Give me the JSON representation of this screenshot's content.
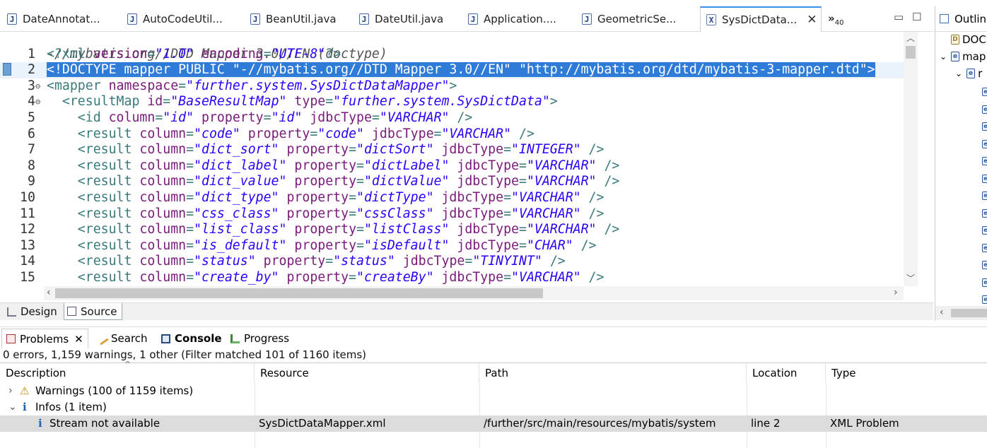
{
  "tabs": [
    {
      "label": "DateAnnotat...",
      "icon": "java-file-icon"
    },
    {
      "label": "AutoCodeUtil...",
      "icon": "java-file-icon"
    },
    {
      "label": "BeanUtil.java",
      "icon": "java-file-icon"
    },
    {
      "label": "DateUtil.java",
      "icon": "java-file-icon"
    },
    {
      "label": "Application....",
      "icon": "java-file-icon"
    },
    {
      "label": "GeometricSe...",
      "icon": "java-file-icon"
    },
    {
      "label": "SysDictData...",
      "icon": "xml-file-icon",
      "active": true
    }
  ],
  "tab_overflow": {
    "symbol": "»",
    "count": "40"
  },
  "editor": {
    "doctype_hint": "-//mybatis.org//DTD Mapper 3.0//EN (doctype)",
    "lines": [
      {
        "n": "1",
        "seg": [
          [
            "pi",
            "<?xml "
          ],
          [
            "att",
            "version"
          ],
          [
            "tag",
            "="
          ],
          [
            "val",
            "\"1.0\""
          ],
          [
            "att",
            " encoding"
          ],
          [
            "tag",
            "="
          ],
          [
            "val",
            "\"UTF-8\""
          ],
          [
            "pi",
            "?>"
          ]
        ]
      },
      {
        "n": "2",
        "selected": true,
        "seg": [
          [
            "sel",
            "<!DOCTYPE mapper PUBLIC \"-//mybatis.org//DTD Mapper 3.0//EN\" \"http://mybatis.org/dtd/mybatis-3-mapper.dtd\">"
          ]
        ]
      },
      {
        "n": "3",
        "fold": "⊖",
        "seg": [
          [
            "tag",
            "<mapper "
          ],
          [
            "att",
            "namespace"
          ],
          [
            "tag",
            "="
          ],
          [
            "val",
            "\"further.system.SysDictDataMapper\""
          ],
          [
            "tag",
            ">"
          ]
        ]
      },
      {
        "n": "4",
        "fold": "⊖",
        "seg": [
          [
            "tag",
            "  <resultMap "
          ],
          [
            "att",
            "id"
          ],
          [
            "tag",
            "="
          ],
          [
            "val",
            "\"BaseResultMap\""
          ],
          [
            "att",
            " type"
          ],
          [
            "tag",
            "="
          ],
          [
            "val",
            "\"further.system.SysDictData\""
          ],
          [
            "tag",
            ">"
          ]
        ]
      },
      {
        "n": "5",
        "seg": [
          [
            "tag",
            "    <id "
          ],
          [
            "att",
            "column"
          ],
          [
            "tag",
            "="
          ],
          [
            "val",
            "\"id\""
          ],
          [
            "att",
            " property"
          ],
          [
            "tag",
            "="
          ],
          [
            "val",
            "\"id\""
          ],
          [
            "att",
            " jdbcType"
          ],
          [
            "tag",
            "="
          ],
          [
            "val",
            "\"VARCHAR\""
          ],
          [
            "tag",
            " />"
          ]
        ]
      },
      {
        "n": "6",
        "seg": [
          [
            "tag",
            "    <result "
          ],
          [
            "att",
            "column"
          ],
          [
            "tag",
            "="
          ],
          [
            "val",
            "\"code\""
          ],
          [
            "att",
            " property"
          ],
          [
            "tag",
            "="
          ],
          [
            "val",
            "\"code\""
          ],
          [
            "att",
            " jdbcType"
          ],
          [
            "tag",
            "="
          ],
          [
            "val",
            "\"VARCHAR\""
          ],
          [
            "tag",
            " />"
          ]
        ]
      },
      {
        "n": "7",
        "seg": [
          [
            "tag",
            "    <result "
          ],
          [
            "att",
            "column"
          ],
          [
            "tag",
            "="
          ],
          [
            "val",
            "\"dict_sort\""
          ],
          [
            "att",
            " property"
          ],
          [
            "tag",
            "="
          ],
          [
            "val",
            "\"dictSort\""
          ],
          [
            "att",
            " jdbcType"
          ],
          [
            "tag",
            "="
          ],
          [
            "val",
            "\"INTEGER\""
          ],
          [
            "tag",
            " />"
          ]
        ]
      },
      {
        "n": "8",
        "seg": [
          [
            "tag",
            "    <result "
          ],
          [
            "att",
            "column"
          ],
          [
            "tag",
            "="
          ],
          [
            "val",
            "\"dict_label\""
          ],
          [
            "att",
            " property"
          ],
          [
            "tag",
            "="
          ],
          [
            "val",
            "\"dictLabel\""
          ],
          [
            "att",
            " jdbcType"
          ],
          [
            "tag",
            "="
          ],
          [
            "val",
            "\"VARCHAR\""
          ],
          [
            "tag",
            " />"
          ]
        ]
      },
      {
        "n": "9",
        "seg": [
          [
            "tag",
            "    <result "
          ],
          [
            "att",
            "column"
          ],
          [
            "tag",
            "="
          ],
          [
            "val",
            "\"dict_value\""
          ],
          [
            "att",
            " property"
          ],
          [
            "tag",
            "="
          ],
          [
            "val",
            "\"dictValue\""
          ],
          [
            "att",
            " jdbcType"
          ],
          [
            "tag",
            "="
          ],
          [
            "val",
            "\"VARCHAR\""
          ],
          [
            "tag",
            " />"
          ]
        ]
      },
      {
        "n": "10",
        "seg": [
          [
            "tag",
            "    <result "
          ],
          [
            "att",
            "column"
          ],
          [
            "tag",
            "="
          ],
          [
            "val",
            "\"dict_type\""
          ],
          [
            "att",
            " property"
          ],
          [
            "tag",
            "="
          ],
          [
            "val",
            "\"dictType\""
          ],
          [
            "att",
            " jdbcType"
          ],
          [
            "tag",
            "="
          ],
          [
            "val",
            "\"VARCHAR\""
          ],
          [
            "tag",
            " />"
          ]
        ]
      },
      {
        "n": "11",
        "seg": [
          [
            "tag",
            "    <result "
          ],
          [
            "att",
            "column"
          ],
          [
            "tag",
            "="
          ],
          [
            "val",
            "\"css_class\""
          ],
          [
            "att",
            " property"
          ],
          [
            "tag",
            "="
          ],
          [
            "val",
            "\"cssClass\""
          ],
          [
            "att",
            " jdbcType"
          ],
          [
            "tag",
            "="
          ],
          [
            "val",
            "\"VARCHAR\""
          ],
          [
            "tag",
            " />"
          ]
        ]
      },
      {
        "n": "12",
        "seg": [
          [
            "tag",
            "    <result "
          ],
          [
            "att",
            "column"
          ],
          [
            "tag",
            "="
          ],
          [
            "val",
            "\"list_class\""
          ],
          [
            "att",
            " property"
          ],
          [
            "tag",
            "="
          ],
          [
            "val",
            "\"listClass\""
          ],
          [
            "att",
            " jdbcType"
          ],
          [
            "tag",
            "="
          ],
          [
            "val",
            "\"VARCHAR\""
          ],
          [
            "tag",
            " />"
          ]
        ]
      },
      {
        "n": "13",
        "seg": [
          [
            "tag",
            "    <result "
          ],
          [
            "att",
            "column"
          ],
          [
            "tag",
            "="
          ],
          [
            "val",
            "\"is_default\""
          ],
          [
            "att",
            " property"
          ],
          [
            "tag",
            "="
          ],
          [
            "val",
            "\"isDefault\""
          ],
          [
            "att",
            " jdbcType"
          ],
          [
            "tag",
            "="
          ],
          [
            "val",
            "\"CHAR\""
          ],
          [
            "tag",
            " />"
          ]
        ]
      },
      {
        "n": "14",
        "seg": [
          [
            "tag",
            "    <result "
          ],
          [
            "att",
            "column"
          ],
          [
            "tag",
            "="
          ],
          [
            "val",
            "\"status\""
          ],
          [
            "att",
            " property"
          ],
          [
            "tag",
            "="
          ],
          [
            "val",
            "\"status\""
          ],
          [
            "att",
            " jdbcType"
          ],
          [
            "tag",
            "="
          ],
          [
            "val",
            "\"TINYINT\""
          ],
          [
            "tag",
            " />"
          ]
        ]
      },
      {
        "n": "15",
        "seg": [
          [
            "tag",
            "    <result "
          ],
          [
            "att",
            "column"
          ],
          [
            "tag",
            "="
          ],
          [
            "val",
            "\"create_by\""
          ],
          [
            "att",
            " property"
          ],
          [
            "tag",
            "="
          ],
          [
            "val",
            "\"createBy\""
          ],
          [
            "att",
            " jdbcType"
          ],
          [
            "tag",
            "="
          ],
          [
            "val",
            "\"VARCHAR\""
          ],
          [
            "tag",
            " />"
          ]
        ]
      }
    ]
  },
  "bottom_tabs": {
    "design": "Design",
    "source": "Source"
  },
  "outline": {
    "title": "Outlin",
    "rows": [
      {
        "label": "DOC"
      },
      {
        "label": "map"
      },
      {
        "label": "r"
      }
    ]
  },
  "problems": {
    "tabs": {
      "problems": "Problems",
      "search": "Search",
      "console": "Console",
      "progress": "Progress"
    },
    "summary": "0 errors, 1,159 warnings, 1 other (Filter matched 101 of 1160 items)",
    "columns": [
      "Description",
      "Resource",
      "Path",
      "Location",
      "Type"
    ],
    "rows": [
      {
        "expander": "›",
        "icon": "warning-icon",
        "description": "Warnings (100 of 1159 items)",
        "resource": "",
        "path": "",
        "location": "",
        "type": ""
      },
      {
        "expander": "⌄",
        "icon": "info-icon",
        "description": "Infos (1 item)",
        "resource": "",
        "path": "",
        "location": "",
        "type": ""
      },
      {
        "expander": "",
        "icon": "info-icon",
        "description": "Stream not available",
        "resource": "SysDictDataMapper.xml",
        "path": "/further/src/main/resources/mybatis/system",
        "location": "line 2",
        "type": "XML Problem",
        "selected": true
      }
    ]
  },
  "colors": {
    "selection": "#2f7bd8",
    "tag": "#3a7a7a",
    "attribute": "#7a1a7a",
    "value": "#2a00ff"
  }
}
